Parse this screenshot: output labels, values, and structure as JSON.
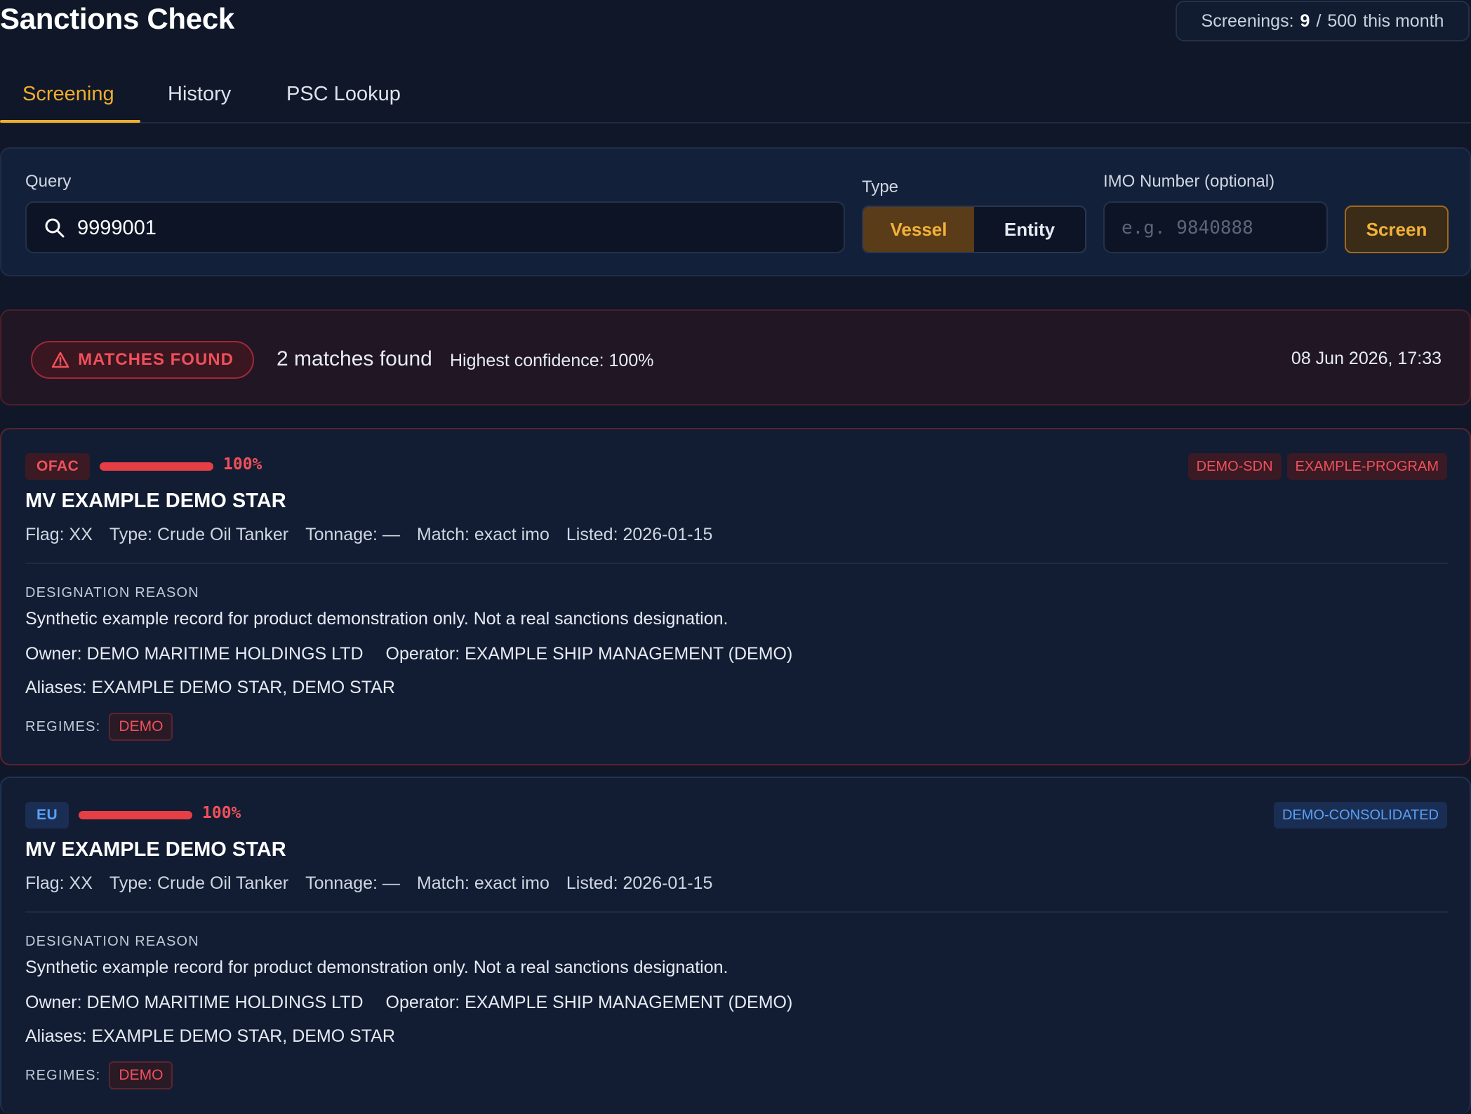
{
  "header": {
    "title": "Sanctions Check",
    "usage": {
      "prefix": "Screenings:",
      "used": "9",
      "separator": "/",
      "limit": "500",
      "suffix": "this month"
    }
  },
  "tabs": [
    {
      "label": "Screening",
      "active": true
    },
    {
      "label": "History",
      "active": false
    },
    {
      "label": "PSC Lookup",
      "active": false
    }
  ],
  "search": {
    "query_label": "Query",
    "query_value": "9999001",
    "type_label": "Type",
    "type_options": [
      "Vessel",
      "Entity"
    ],
    "type_selected": "Vessel",
    "imo_label": "IMO Number (optional)",
    "imo_placeholder": "e.g. 9840888",
    "submit_label": "Screen"
  },
  "summary": {
    "status": "MATCHES FOUND",
    "count_text": "2 matches found",
    "confidence_text": "Highest confidence: 100%",
    "timestamp": "08 Jun 2026, 17:33"
  },
  "results": [
    {
      "source": "OFAC",
      "confidence": 1.0,
      "confidence_text": "100%",
      "programs": [
        "DEMO-SDN",
        "EXAMPLE-PROGRAM"
      ],
      "name": "MV EXAMPLE DEMO STAR",
      "flag": "Flag: XX",
      "type": "Type: Crude Oil Tanker",
      "tonnage": "Tonnage: —",
      "match": "Match: exact imo",
      "listed": "Listed: 2026-01-15",
      "designation_label": "DESIGNATION REASON",
      "designation_reason": "Synthetic example record for product demonstration only. Not a real sanctions designation.",
      "owner": "Owner: DEMO MARITIME HOLDINGS LTD",
      "operator": "Operator: EXAMPLE SHIP MANAGEMENT (DEMO)",
      "aliases": "Aliases: EXAMPLE DEMO STAR, DEMO STAR",
      "regimes_label": "REGIMES:",
      "regimes": [
        "DEMO"
      ]
    },
    {
      "source": "EU",
      "confidence": 1.0,
      "confidence_text": "100%",
      "programs": [
        "DEMO-CONSOLIDATED"
      ],
      "name": "MV EXAMPLE DEMO STAR",
      "flag": "Flag: XX",
      "type": "Type: Crude Oil Tanker",
      "tonnage": "Tonnage: —",
      "match": "Match: exact imo",
      "listed": "Listed: 2026-01-15",
      "designation_label": "DESIGNATION REASON",
      "designation_reason": "Synthetic example record for product demonstration only. Not a real sanctions designation.",
      "owner": "Owner: DEMO MARITIME HOLDINGS LTD",
      "operator": "Operator: EXAMPLE SHIP MANAGEMENT (DEMO)",
      "aliases": "Aliases: EXAMPLE DEMO STAR, DEMO STAR",
      "regimes_label": "REGIMES:",
      "regimes": [
        "DEMO"
      ]
    }
  ],
  "colors": {
    "accent": "#f0ad2a",
    "danger": "#f0505a",
    "info": "#5aa0f5",
    "background": "#0f1729"
  },
  "icons": {
    "search": "search-icon",
    "warning": "warning-triangle-icon"
  }
}
